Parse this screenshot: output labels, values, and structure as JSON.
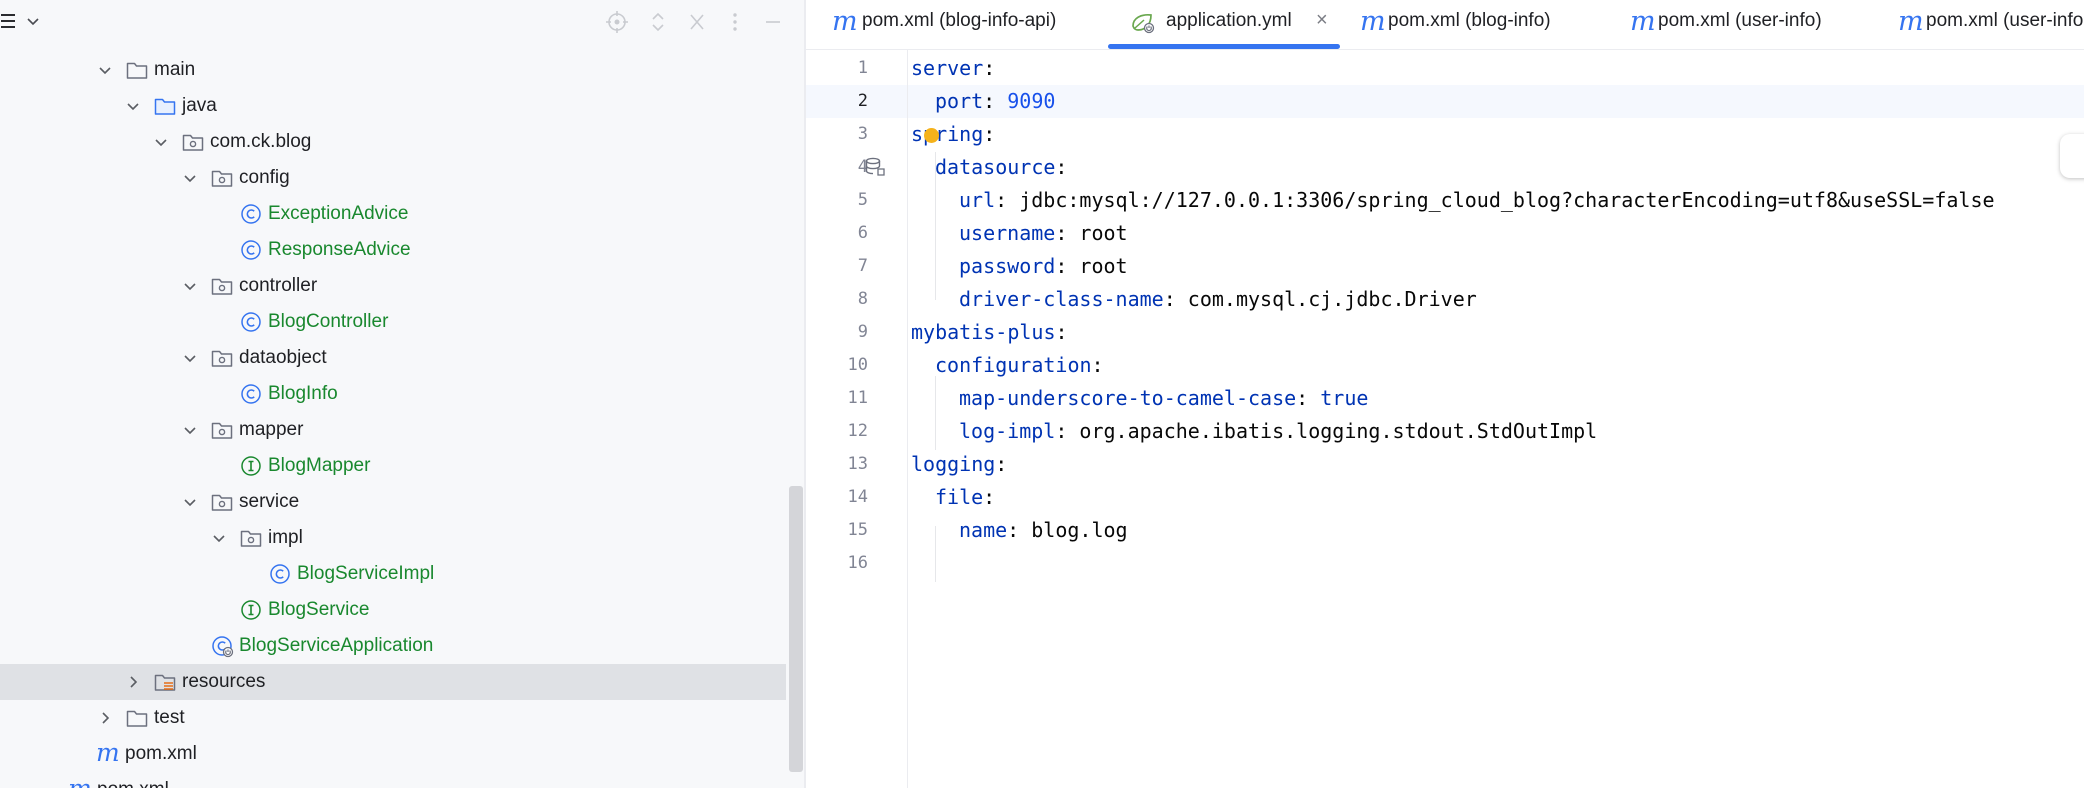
{
  "project_panel": {
    "rows": [
      {
        "label": "main",
        "kind": "folder"
      },
      {
        "label": "java",
        "kind": "src-folder"
      },
      {
        "label": "com.ck.blog",
        "kind": "package"
      },
      {
        "label": "config",
        "kind": "package"
      },
      {
        "label": "ExceptionAdvice",
        "kind": "class"
      },
      {
        "label": "ResponseAdvice",
        "kind": "class"
      },
      {
        "label": "controller",
        "kind": "package"
      },
      {
        "label": "BlogController",
        "kind": "class"
      },
      {
        "label": "dataobject",
        "kind": "package"
      },
      {
        "label": "BlogInfo",
        "kind": "class"
      },
      {
        "label": "mapper",
        "kind": "package"
      },
      {
        "label": "BlogMapper",
        "kind": "interface"
      },
      {
        "label": "service",
        "kind": "package"
      },
      {
        "label": "impl",
        "kind": "package"
      },
      {
        "label": "BlogServiceImpl",
        "kind": "class"
      },
      {
        "label": "BlogService",
        "kind": "interface"
      },
      {
        "label": "BlogServiceApplication",
        "kind": "app-class"
      },
      {
        "label": "resources",
        "kind": "resources"
      },
      {
        "label": "test",
        "kind": "folder"
      },
      {
        "label": "pom.xml",
        "kind": "maven"
      },
      {
        "label": "pom.xml",
        "kind": "maven"
      }
    ]
  },
  "tabs": [
    {
      "label": "pom.xml (blog-info-api)",
      "icon": "m"
    },
    {
      "label": "application.yml",
      "icon": "spring-yml",
      "active": true,
      "close": "×"
    },
    {
      "label": "pom.xml (blog-info)",
      "icon": "m"
    },
    {
      "label": "pom.xml (user-info)",
      "icon": "m"
    },
    {
      "label": "pom.xml (user-info",
      "icon": "m"
    }
  ],
  "editor": {
    "line_numbers": [
      "1",
      "2",
      "3",
      "4",
      "5",
      "6",
      "7",
      "8",
      "9",
      "10",
      "11",
      "12",
      "13",
      "14",
      "15",
      "16"
    ],
    "current_line": "2",
    "lines": [
      {
        "key": "server",
        "sep": ":",
        "value": ""
      },
      {
        "key": "port",
        "sep": ": ",
        "value": "9090"
      },
      {
        "key": "spring",
        "sep": ":",
        "value": ""
      },
      {
        "key": "datasource",
        "sep": ":",
        "value": ""
      },
      {
        "key": "url",
        "sep": ": ",
        "value": "jdbc:mysql://127.0.0.1:3306/spring_cloud_blog?characterEncoding=utf8&useSSL=false"
      },
      {
        "key": "username",
        "sep": ": ",
        "value": "root"
      },
      {
        "key": "password",
        "sep": ": ",
        "value": "root"
      },
      {
        "key": "driver-class-name",
        "sep": ": ",
        "value": "com.mysql.cj.jdbc.Driver"
      },
      {
        "key": "mybatis-plus",
        "sep": ":",
        "value": ""
      },
      {
        "key": "configuration",
        "sep": ":",
        "value": ""
      },
      {
        "key": "map-underscore-to-camel-case",
        "sep": ": ",
        "value": "true"
      },
      {
        "key": "log-impl",
        "sep": ": ",
        "value": "org.apache.ibatis.logging.stdout.StdOutImpl"
      },
      {
        "key": "logging",
        "sep": ":",
        "value": ""
      },
      {
        "key": "file",
        "sep": ":",
        "value": ""
      },
      {
        "key": "name",
        "sep": ": ",
        "value": "blog.log"
      },
      {
        "key": "",
        "sep": "",
        "value": ""
      }
    ]
  },
  "colors": {
    "yaml_key": "#0033b3",
    "number": "#1750eb",
    "class_name": "#19882e",
    "accent": "#3574f0"
  }
}
